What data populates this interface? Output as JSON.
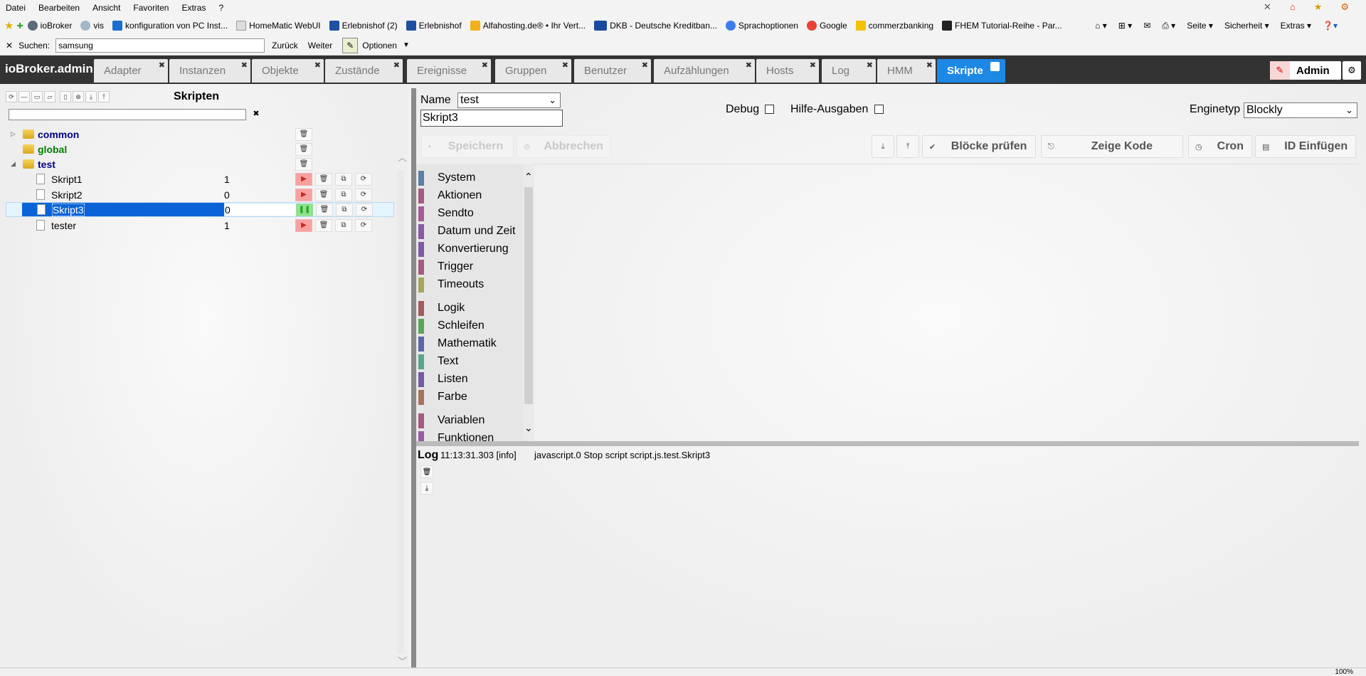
{
  "ie": {
    "menu": [
      "Datei",
      "Bearbeiten",
      "Ansicht",
      "Favoriten",
      "Extras",
      "?"
    ],
    "favorites": [
      {
        "label": "ioBroker",
        "color": "#5b6d7d"
      },
      {
        "label": "vis",
        "color": "#a0b8c8"
      },
      {
        "label": "konfiguration von PC Inst...",
        "color": "#1a6fd0"
      },
      {
        "label": "HomeMatic WebUI",
        "color": "#bbbbbb"
      },
      {
        "label": "Erlebnishof (2)",
        "color": "#1e4fa0"
      },
      {
        "label": "Erlebnishof",
        "color": "#1e4fa0"
      },
      {
        "label": "Alfahosting.de® • Ihr Vert...",
        "color": "#f2b019"
      },
      {
        "label": "DKB - Deutsche Kreditban...",
        "color": "#1a4aa0"
      },
      {
        "label": "Sprachoptionen",
        "color": "#3b7ded"
      },
      {
        "label": "Google",
        "color": "#ea4335"
      },
      {
        "label": "commerzbanking",
        "color": "#f2c200"
      },
      {
        "label": "FHEM Tutorial-Reihe - Par...",
        "color": "#222222"
      }
    ],
    "commands": [
      "Seite ▾",
      "Sicherheit ▾",
      "Extras ▾"
    ],
    "find": {
      "label": "Suchen:",
      "value": "samsung",
      "back": "Zurück",
      "forward": "Weiter",
      "options": "Optionen"
    },
    "zoom": "100%"
  },
  "nav": {
    "brand": "ioBroker.admin",
    "tabs": [
      "Adapter",
      "Instanzen",
      "Objekte",
      "Zustände",
      "Ereignisse",
      "Gruppen",
      "Benutzer",
      "Aufzählungen",
      "Hosts",
      "Log",
      "HMM",
      "Skripte"
    ],
    "admin_label": "Admin"
  },
  "left": {
    "title": "Skripten",
    "folders": [
      {
        "name": "common",
        "color": "#000080"
      },
      {
        "name": "global",
        "color": "#008000"
      },
      {
        "name": "test",
        "color": "#000080"
      }
    ],
    "scripts": [
      {
        "name": "Skript1",
        "count": "1",
        "state": "stopped"
      },
      {
        "name": "Skript2",
        "count": "0",
        "state": "stopped"
      },
      {
        "name": "Skript3",
        "count": "0",
        "state": "running"
      },
      {
        "name": "tester",
        "count": "1",
        "state": "stopped"
      }
    ]
  },
  "right": {
    "name_label": "Name",
    "folder_value": "test",
    "script_name": "Skript3",
    "debug_label": "Debug",
    "help_label": "Hilfe-Ausgaben",
    "engine_label": "Enginetyp",
    "engine_value": "Blockly",
    "buttons": {
      "save": "Speichern",
      "cancel": "Abbrechen",
      "check": "Blöcke prüfen",
      "show_code": "Zeige Kode",
      "cron": "Cron",
      "insert_id": "ID Einfügen"
    },
    "toolbox": [
      {
        "label": "System",
        "color": "#5b80a5"
      },
      {
        "label": "Aktionen",
        "color": "#a55b80"
      },
      {
        "label": "Sendto",
        "color": "#a55b99"
      },
      {
        "label": "Datum und Zeit",
        "color": "#8a5ba5"
      },
      {
        "label": "Konvertierung",
        "color": "#805ba5"
      },
      {
        "label": "Trigger",
        "color": "#a55b80"
      },
      {
        "label": "Timeouts",
        "color": "#a5a55b"
      },
      {
        "label": "Logik",
        "color": "#a55b5b"
      },
      {
        "label": "Schleifen",
        "color": "#5ba55b"
      },
      {
        "label": "Mathematik",
        "color": "#5b67a5"
      },
      {
        "label": "Text",
        "color": "#5ba58c"
      },
      {
        "label": "Listen",
        "color": "#745ba5"
      },
      {
        "label": "Farbe",
        "color": "#a5745b"
      },
      {
        "label": "Variablen",
        "color": "#a55b80"
      },
      {
        "label": "Funktionen",
        "color": "#995ba5"
      }
    ],
    "log": {
      "title": "Log",
      "time": "11:13:31.303 [info]",
      "message": "javascript.0 Stop script script.js.test.Skript3"
    }
  }
}
